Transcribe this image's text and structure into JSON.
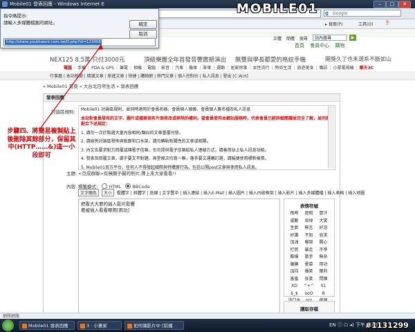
{
  "browser": {
    "window_title": "Mobile01 發表回應 - Windows Internet E",
    "search_placeholder": "Google",
    "toolbar_items": [
      "▸ 頁面(P)",
      "工具(O)",
      "❓"
    ]
  },
  "logo": "MOBILE01",
  "dialog": {
    "line1": "指令碼提示:",
    "line2": "請輸入多媒體檔案的網址。",
    "ok_label": "確定",
    "cancel_label": "取消",
    "input_value": "http://share.youthwant.com.tw/D.php?id=12345678"
  },
  "site": {
    "top_links": [
      "正體",
      "簡體",
      "搜尋"
    ],
    "search_value": "站內搜尋",
    "member_links": [
      "首頁",
      "會員中心",
      "購物",
      "線上商城"
    ],
    "banners": [
      "NEX125 8.5萬 只付3000元",
      "頂級樂團全年首發音響震撼演出",
      "無雙與學長都愛的格紋手機",
      "開獎久了也未選系不斷如山"
    ],
    "nav_main": [
      "電腦",
      "手機",
      "PDA & GPS",
      "筆電",
      "相機",
      "電腦",
      "影音",
      "汽車",
      "機車",
      "單車",
      "運動",
      "居家房事",
      "女性流行",
      "時尚生活",
      "旅遊美食",
      "職訊",
      "小眾電視機",
      "樂天3C"
    ],
    "nav_sub": "行事曆 | 本站新聞 | 精選文章 | 新進文章 | 快捷 | 購物網 | 熱門文章 | 個人控制台 | 私人訊息 | 登出 [C.W.H]",
    "breadcrumb": "» Mobile01 首頁 » 大台北日常生活 » 發表回應"
  },
  "form": {
    "header": "發表回應",
    "rules_label": "討論區規則:",
    "rules_intro": "Mobile01 討論區規則，並同時適用於會員名稱、會員個人頭像、會員個人簽名檔及私人訊息",
    "rules_warning": "本站對會員發布的文字、圖片或檔案保有片面修改或移除的權利。當會員使用本網站服務時，代表會員已經詳細閱讀並完全了解，並同意配合下述規定：",
    "rules_items": [
      "1. 請勿一次於點選大量內容相同/類似的文章重覆刊發。",
      "2. 請避免討論區發佈與版面和口水架，請勿轉貼新聞性的文章或相關。",
      "3. 內文告要求對方回覆或傳電子信箱，也勿提供電子信箱給私人連絡方式，請善用站上私人訊息功能。",
      "4. 發表及回覆文章，請于要文不對題，與堂幾次均寫一聯，落手要文運轉訂選，請擬便使用標新樣張。",
      "5. Mobile01官方平台，任何人不得發起國際與特購實行為，包括公開post文章與使用私人訊息。"
    ],
    "subject_label": "主題:",
    "subject_value": "<亞成群聯>有無關子圖的照片,擇上來大家看看!!",
    "content_label": "內容:",
    "editor_mode_label": "標籤模式:",
    "mode_html": "HTML",
    "mode_bbcode": "BBCode",
    "font_color": "文字顏色",
    "font_size": "大小",
    "editor_tools": "粗體字 | 斜體字 | 底線 | 文字置中 | 插入連結 | 插入E-Mail | 插入圖片 | 插入內嵌框架 | 插入影片 | 插入多媒體檔 | 插入表格 | 插入地圖",
    "editor_text": [
      "把看大大要的插入影片影響",
      "要被插入看看哪用[用功]"
    ],
    "emote_title": "表情符號",
    "emotes": [
      "飛吻",
      "遮瑕",
      "冒汗",
      "咸動",
      "哀悼",
      "大笑",
      "生氣",
      "無言",
      "好浴",
      "好讚",
      "不知",
      "哀求",
      "加油",
      "嚇哭",
      "開心",
      "打死",
      "暴走",
      "不爭",
      "酷爆",
      "歌手",
      "無奈",
      "腼腆",
      "愛慕",
      "用功",
      "加持",
      "爆笑",
      "眼利",
      "害羞",
      "狂笑",
      "閃爍",
      "XD",
      "^+^",
      "01",
      "$_$",
      "ooO",
      "8",
      "流口水",
      "orz",
      "夜宿",
      "飛吻"
    ],
    "read_label": "讀取存檔"
  },
  "annotation": "步驟四、將簡易複製貼上後刪除其餘部分，保留其中(HTTP……&)這一小段即可",
  "taskbar": {
    "tasks": [
      "Mobile01 發表回應",
      "3 · 小畫家",
      "如何讓影片中 [前播",
      ""
    ],
    "tray": "EN ⓘ ☖ ◂) 下午 10:57"
  },
  "status_bar": "網際網路",
  "watermark": "#1131299"
}
